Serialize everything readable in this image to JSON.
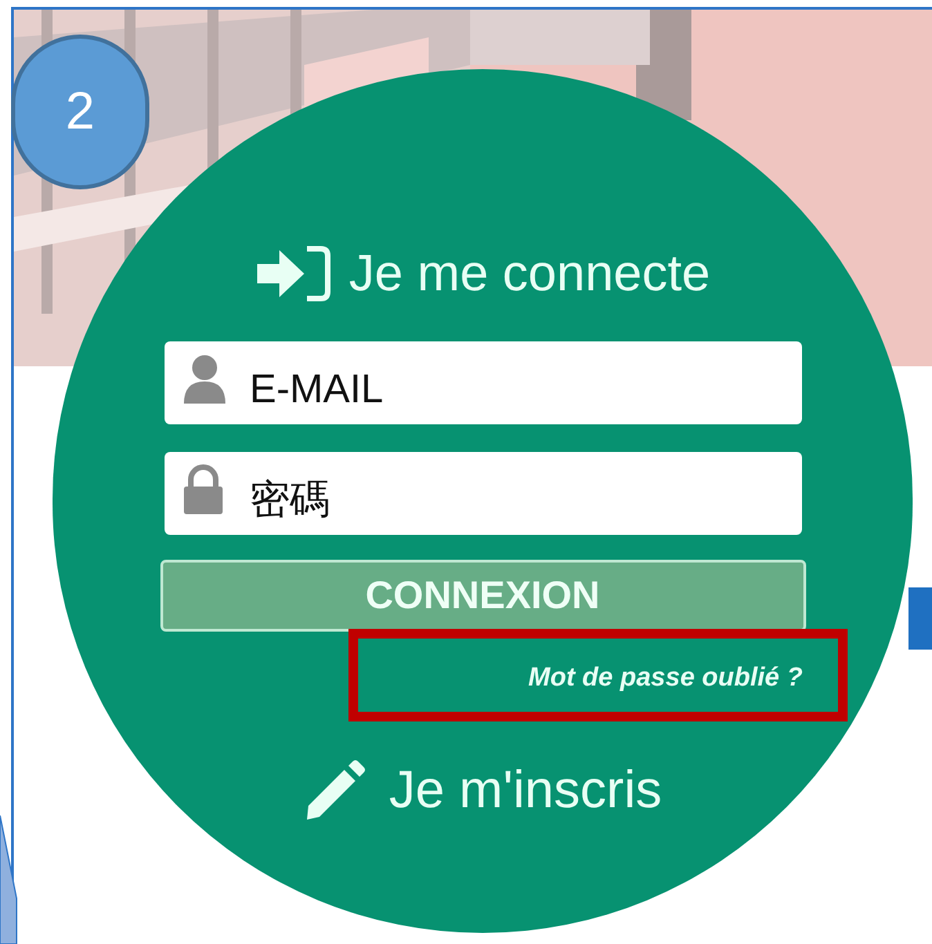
{
  "step_badge": "2",
  "login": {
    "title": "Je me connecte",
    "fields": [
      {
        "kind": "user",
        "placeholder": "E-MAIL"
      },
      {
        "kind": "lock",
        "placeholder": "密碼"
      }
    ],
    "submit": "CONNEXION",
    "forgot_link": {
      "label": "Mot de passe oublié ?",
      "highlighted": true
    },
    "register": "Je m'inscris"
  }
}
